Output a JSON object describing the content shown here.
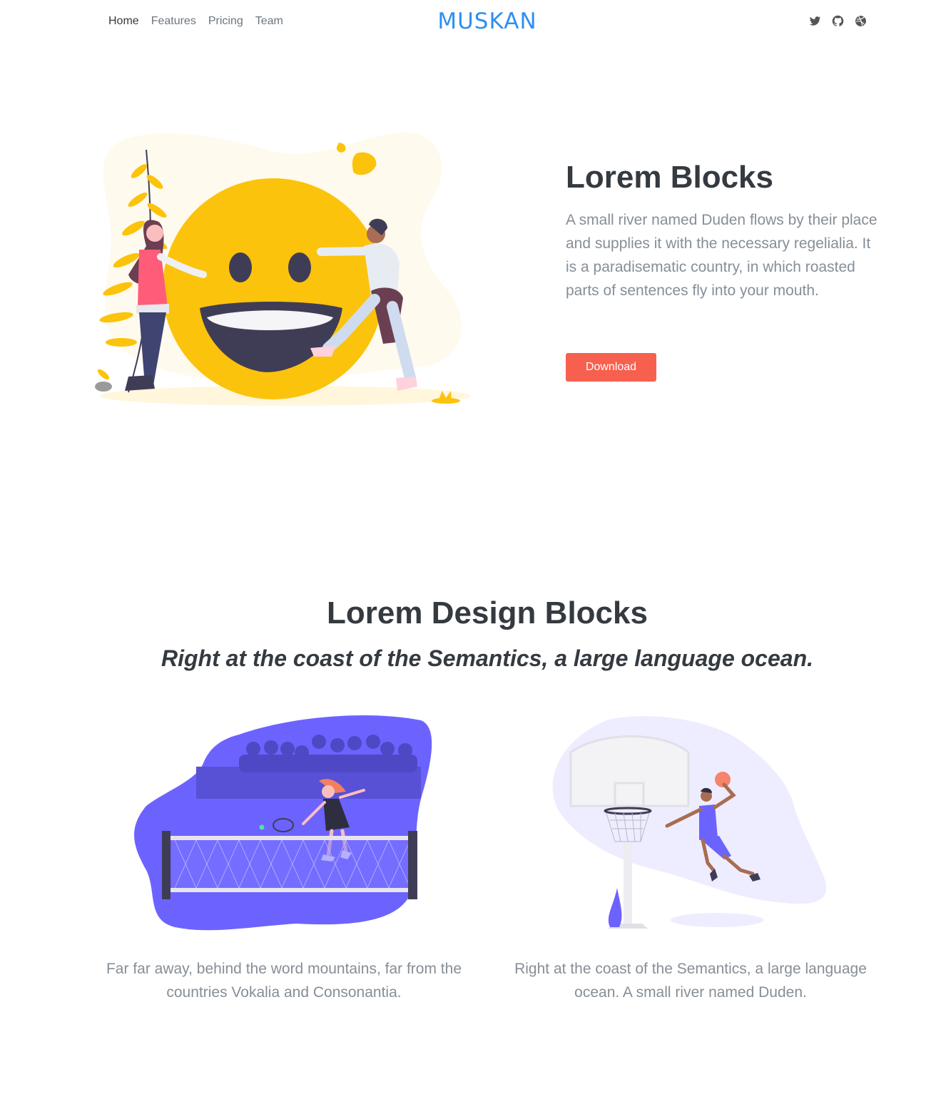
{
  "nav": {
    "links": [
      "Home",
      "Features",
      "Pricing",
      "Team"
    ],
    "active": "Home",
    "brand": "MUSKAN",
    "social_icons": [
      "twitter-icon",
      "github-icon",
      "dribbble-icon"
    ]
  },
  "hero": {
    "title": "Lorem Blocks",
    "description": "A small river named Duden flows by their place and supplies it with the necessary regelialia. It is a paradisematic country, in which roasted parts of sentences fly into your mouth.",
    "button_label": "Download",
    "accent_color": "#f7604f"
  },
  "features": {
    "title": "Lorem Design Blocks",
    "subtitle": "Right at the coast of the Semantics, a large language ocean.",
    "cards": [
      {
        "text": "Far far away, behind the word mountains, far from the countries Vokalia and Consonantia."
      },
      {
        "text": "Right at the coast of the Semantics, a large language ocean. A small river named Duden."
      }
    ]
  },
  "colors": {
    "brand": "#2f8ff0",
    "heading": "#343a40",
    "muted": "#868e96",
    "purple": "#6c63ff",
    "yellow": "#fcc30c"
  }
}
